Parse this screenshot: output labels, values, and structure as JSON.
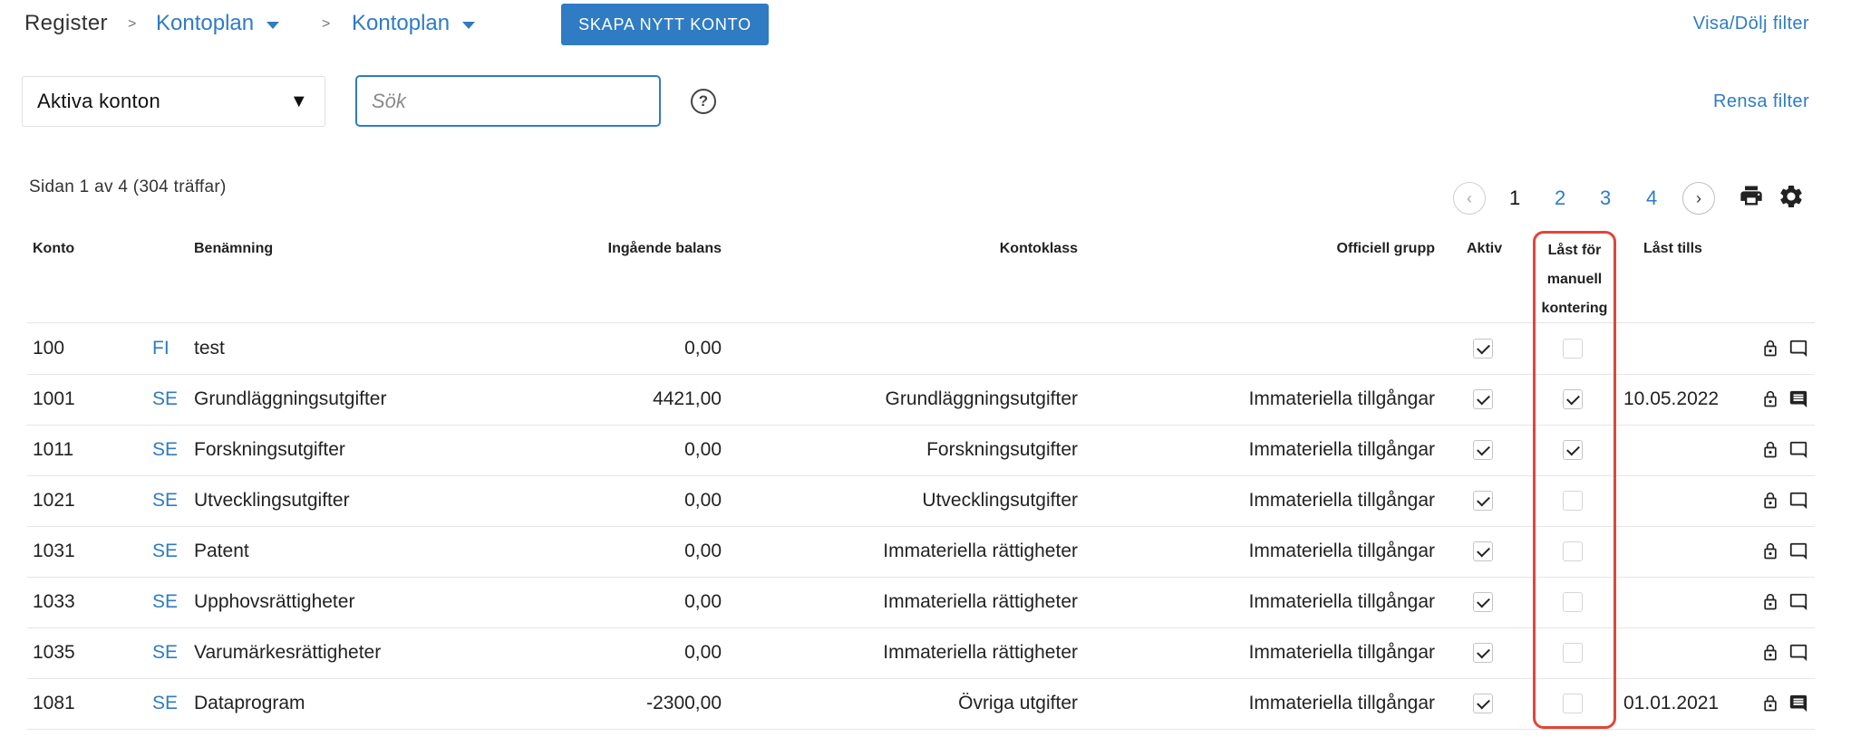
{
  "breadcrumb": {
    "root": "Register",
    "sep": ">",
    "items": [
      {
        "label": "Kontoplan"
      },
      {
        "label": "Kontoplan"
      }
    ]
  },
  "toolbar": {
    "create_label": "SKAPA NYTT KONTO",
    "toggle_filter_label": "Visa/Dölj filter",
    "clear_filter_label": "Rensa filter"
  },
  "filter": {
    "selected": "Aktiva konton",
    "search_placeholder": "Sök",
    "help_glyph": "?"
  },
  "pagination": {
    "info": "Sidan 1 av 4  (304 träffar)",
    "pages": [
      "1",
      "2",
      "3",
      "4"
    ],
    "current": "1",
    "prev_glyph": "‹",
    "next_glyph": "›"
  },
  "table": {
    "headers": {
      "konto": "Konto",
      "benamning": "Benämning",
      "ingaende": "Ingående balans",
      "kontoklass": "Kontoklass",
      "officiell": "Officiell grupp",
      "aktiv": "Aktiv",
      "last_line1": "Låst för",
      "last_line2": "manuell",
      "last_line3": "kontering",
      "last_tills": "Låst tills"
    },
    "rows": [
      {
        "konto": "100",
        "lang": "FI",
        "name": "test",
        "balance": "0,00",
        "klass": "",
        "grupp": "",
        "aktiv": true,
        "last": false,
        "tills": "",
        "comment_filled": false
      },
      {
        "konto": "1001",
        "lang": "SE",
        "name": "Grundläggningsutgifter",
        "balance": "4421,00",
        "klass": "Grundläggningsutgifter",
        "grupp": "Immateriella tillgångar",
        "aktiv": true,
        "last": true,
        "tills": "10.05.2022",
        "comment_filled": true
      },
      {
        "konto": "1011",
        "lang": "SE",
        "name": "Forskningsutgifter",
        "balance": "0,00",
        "klass": "Forskningsutgifter",
        "grupp": "Immateriella tillgångar",
        "aktiv": true,
        "last": true,
        "tills": "",
        "comment_filled": false
      },
      {
        "konto": "1021",
        "lang": "SE",
        "name": "Utvecklingsutgifter",
        "balance": "0,00",
        "klass": "Utvecklingsutgifter",
        "grupp": "Immateriella tillgångar",
        "aktiv": true,
        "last": false,
        "tills": "",
        "comment_filled": false
      },
      {
        "konto": "1031",
        "lang": "SE",
        "name": "Patent",
        "balance": "0,00",
        "klass": "Immateriella rättigheter",
        "grupp": "Immateriella tillgångar",
        "aktiv": true,
        "last": false,
        "tills": "",
        "comment_filled": false
      },
      {
        "konto": "1033",
        "lang": "SE",
        "name": "Upphovsrättigheter",
        "balance": "0,00",
        "klass": "Immateriella rättigheter",
        "grupp": "Immateriella tillgångar",
        "aktiv": true,
        "last": false,
        "tills": "",
        "comment_filled": false
      },
      {
        "konto": "1035",
        "lang": "SE",
        "name": "Varumärkesrättigheter",
        "balance": "0,00",
        "klass": "Immateriella rättigheter",
        "grupp": "Immateriella tillgångar",
        "aktiv": true,
        "last": false,
        "tills": "",
        "comment_filled": false
      },
      {
        "konto": "1081",
        "lang": "SE",
        "name": "Dataprogram",
        "balance": "-2300,00",
        "klass": "Övriga utgifter",
        "grupp": "Immateriella tillgångar",
        "aktiv": true,
        "last": false,
        "tills": "01.01.2021",
        "comment_filled": true
      }
    ]
  },
  "icons": {
    "dropdown": "chevron-down-icon",
    "help": "help-circle-icon",
    "print": "print-icon",
    "settings": "gear-icon",
    "lock": "lock-icon",
    "comment": "comment-icon"
  },
  "colors": {
    "accent": "#2f7bc4",
    "highlight": "#e0463a"
  }
}
